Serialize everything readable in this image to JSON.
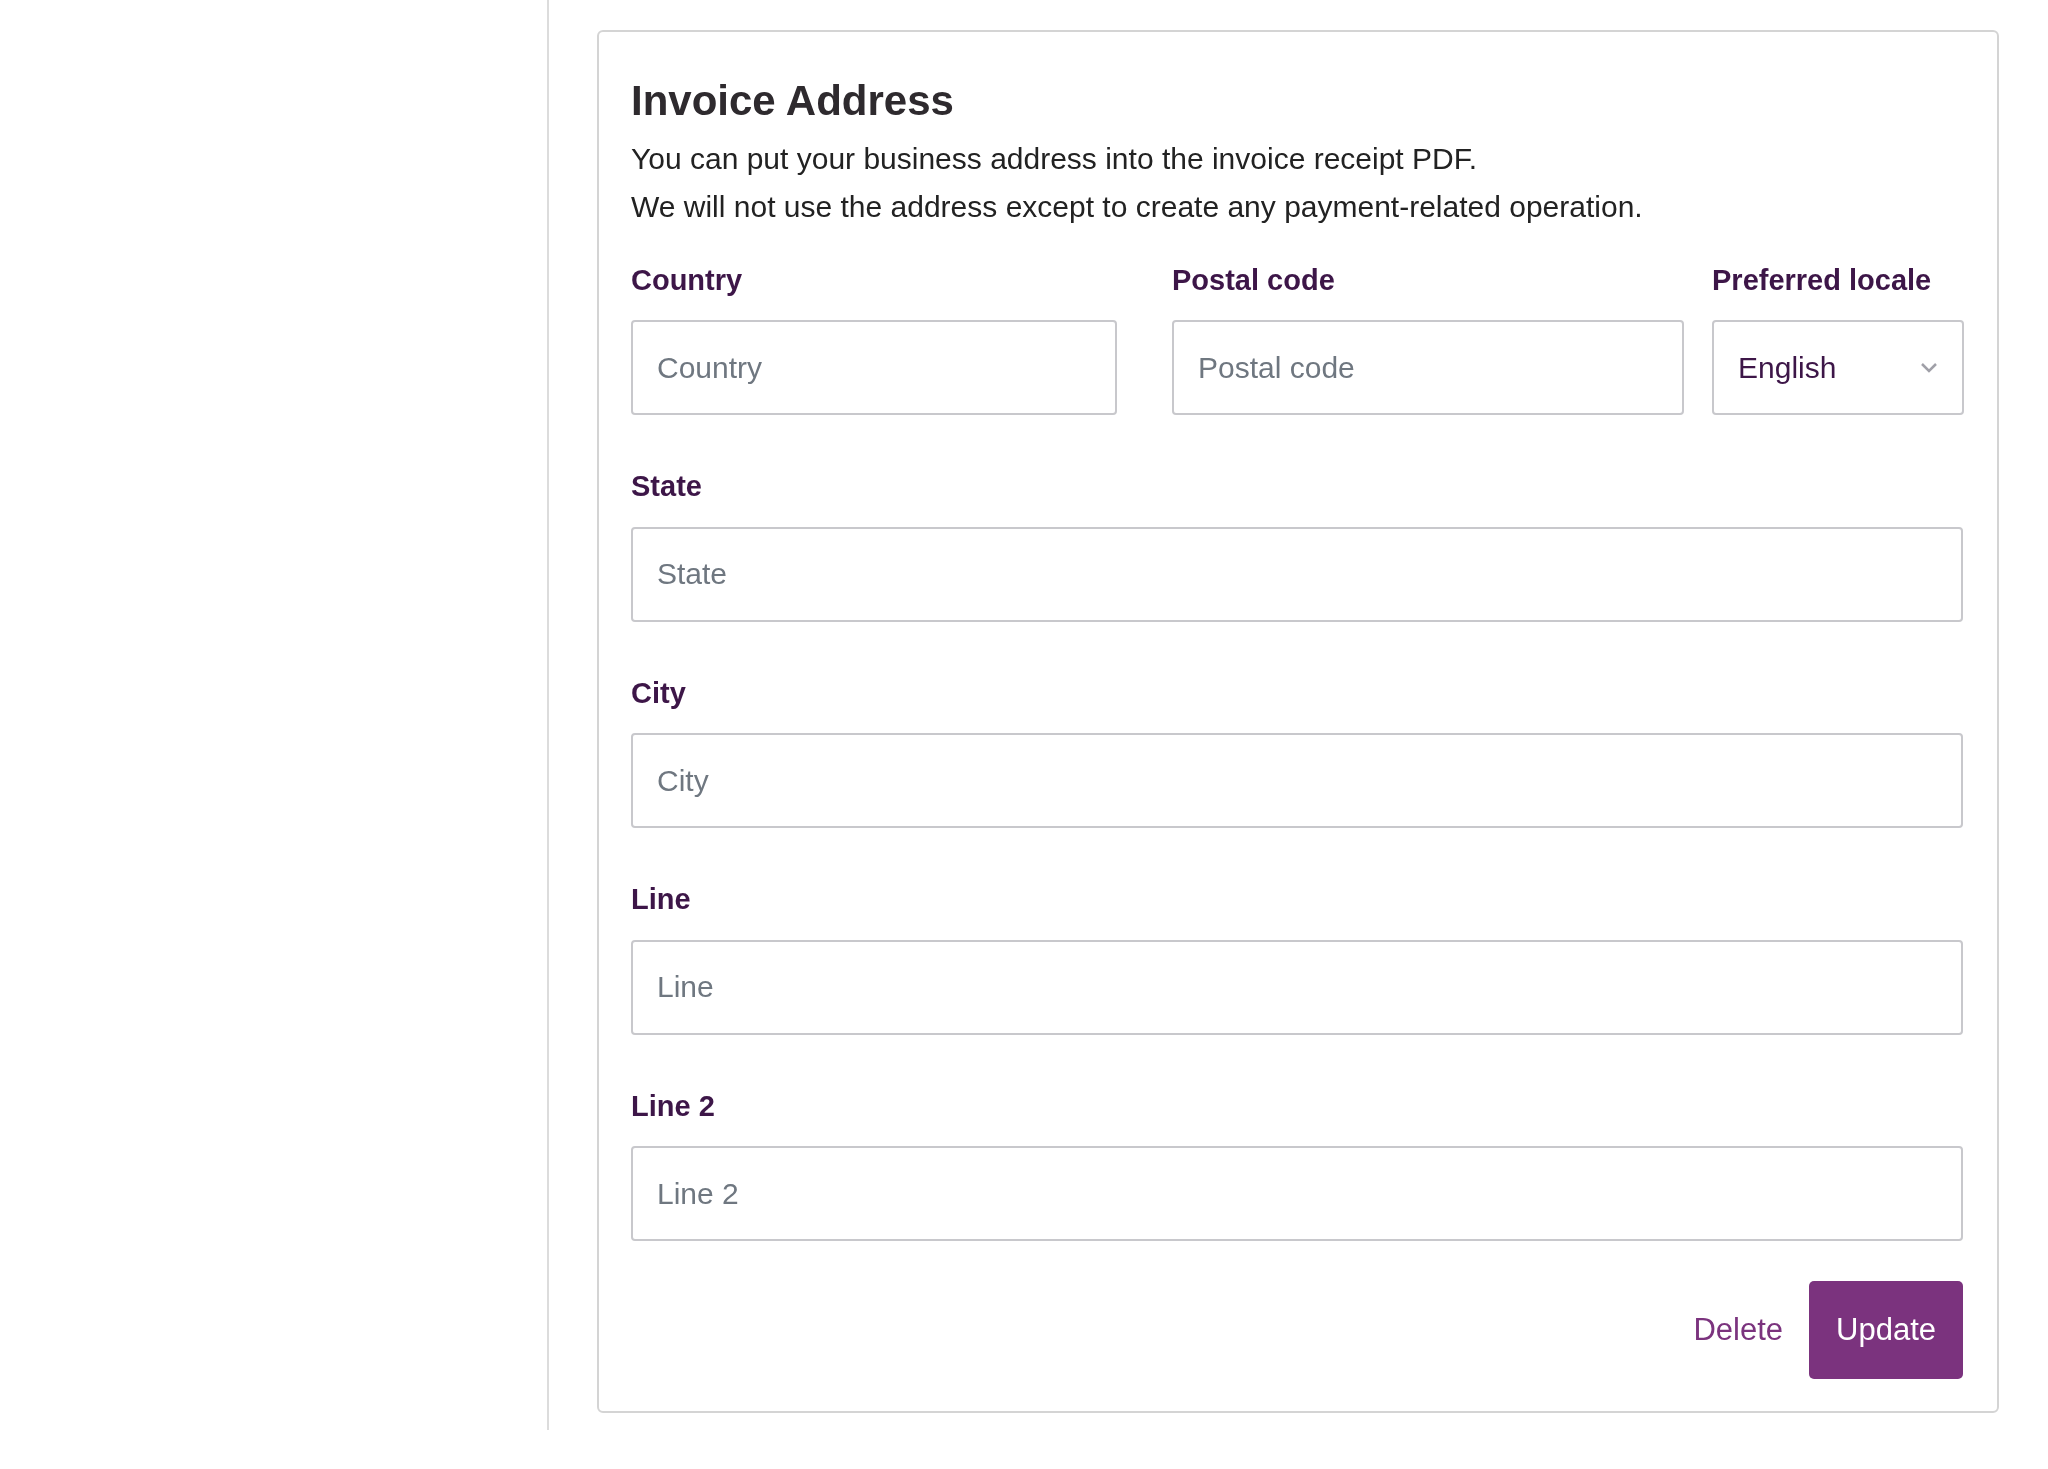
{
  "title": "Invoice Address",
  "description": [
    "You can put your business address into the invoice receipt PDF.",
    "We will not use the address except to create any payment-related operation."
  ],
  "top_fields": [
    {
      "kind": "text",
      "label": "Country",
      "placeholder": "Country"
    },
    {
      "kind": "text",
      "label": "Postal code",
      "placeholder": "Postal code"
    },
    {
      "kind": "select",
      "label": "Preferred locale",
      "value": "English"
    }
  ],
  "fields": [
    {
      "label": "State",
      "placeholder": "State"
    },
    {
      "label": "City",
      "placeholder": "City"
    },
    {
      "label": "Line",
      "placeholder": "Line"
    },
    {
      "label": "Line 2",
      "placeholder": "Line 2"
    }
  ],
  "actions": {
    "delete": "Delete",
    "update": "Update"
  }
}
